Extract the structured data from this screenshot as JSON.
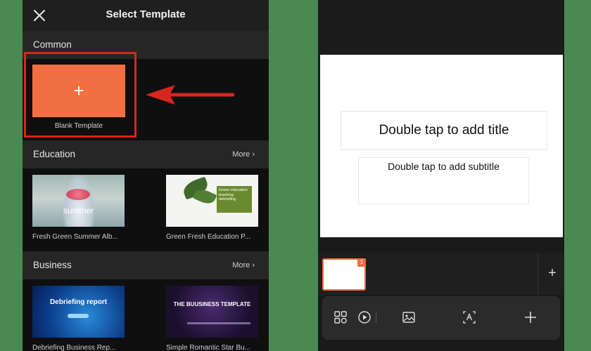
{
  "left": {
    "title": "Select Template",
    "sections": {
      "common": {
        "title": "Common",
        "blank_label": "Blank Template"
      },
      "education": {
        "title": "Education",
        "more": "More",
        "items": [
          {
            "label": "Fresh Green Summer Alb...",
            "thumb_text": "summer"
          },
          {
            "label": "Green  Fresh Education P...",
            "thumb_text": "Green education teaching debriefing"
          }
        ]
      },
      "business": {
        "title": "Business",
        "more": "More",
        "items": [
          {
            "label": "Debriefing Business Rep...",
            "thumb_text": "Debriefing report"
          },
          {
            "label": "Simple Romantic Star Bu...",
            "thumb_text": "THE BUUSINESS TEMPLATE"
          }
        ]
      }
    }
  },
  "right": {
    "slide_title_placeholder": "Double tap to add title",
    "slide_subtitle_placeholder": "Double tap to add subtitle",
    "slide_number": "1"
  },
  "colors": {
    "accent": "#f26f43",
    "highlight": "#d8261f",
    "background": "#4a8a52"
  }
}
